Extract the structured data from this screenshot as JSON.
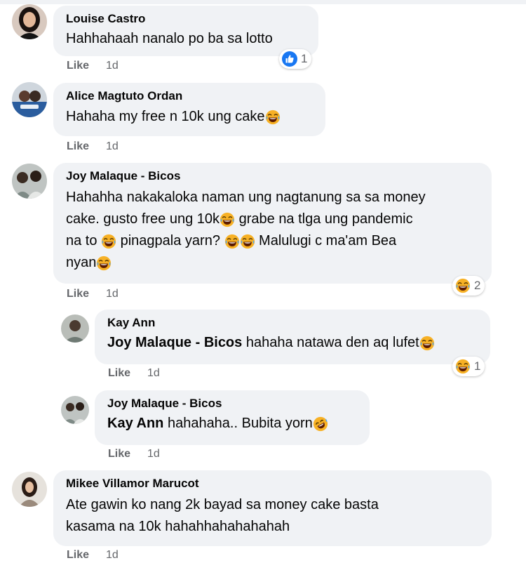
{
  "comments": [
    {
      "author": "Louise Castro",
      "text": "Hahhahaah nanalo po ba sa lotto",
      "like_label": "Like",
      "time": "1d",
      "reaction": {
        "type": "like",
        "count": "1"
      }
    },
    {
      "author": "Alice Magtuto Ordan",
      "text": "Hahaha my free n 10k ung cake",
      "like_label": "Like",
      "time": "1d"
    },
    {
      "author": "Joy Malaque - Bicos",
      "lines": [
        "Hahahha nakakaloka naman ung nagtanung sa sa money",
        "cake. gusto free ung 10k",
        " grabe na tlga ung pandemic",
        "na to ",
        " pinagpala yarn? ",
        " Malulugi c ma'am Bea",
        "nyan"
      ],
      "like_label": "Like",
      "time": "1d",
      "reaction": {
        "type": "haha",
        "count": "2"
      }
    },
    {
      "author": "Kay Ann",
      "mention": "Joy Malaque - Bicos",
      "text": " hahaha natawa den aq lufet",
      "like_label": "Like",
      "time": "1d",
      "reaction": {
        "type": "haha",
        "count": "1"
      }
    },
    {
      "author": "Joy Malaque - Bicos",
      "mention": "Kay Ann",
      "text": " hahahaha.. Bubita yorn",
      "like_label": "Like",
      "time": "1d"
    },
    {
      "author": "Mikee Villamor Marucot",
      "lines": [
        "Ate gawin ko nang 2k bayad sa money cake basta",
        "kasama na 10k hahahhahahahahah"
      ],
      "like_label": "Like",
      "time": "1d"
    }
  ],
  "colors": {
    "bubble": "#f0f2f5",
    "meta": "#65676b",
    "like_blue": "#1877f2",
    "emoji_yellow": "#f7b125"
  },
  "icons": [
    "laughing-tears-emoji",
    "rofl-emoji",
    "like-reaction-icon",
    "haha-reaction-icon"
  ]
}
